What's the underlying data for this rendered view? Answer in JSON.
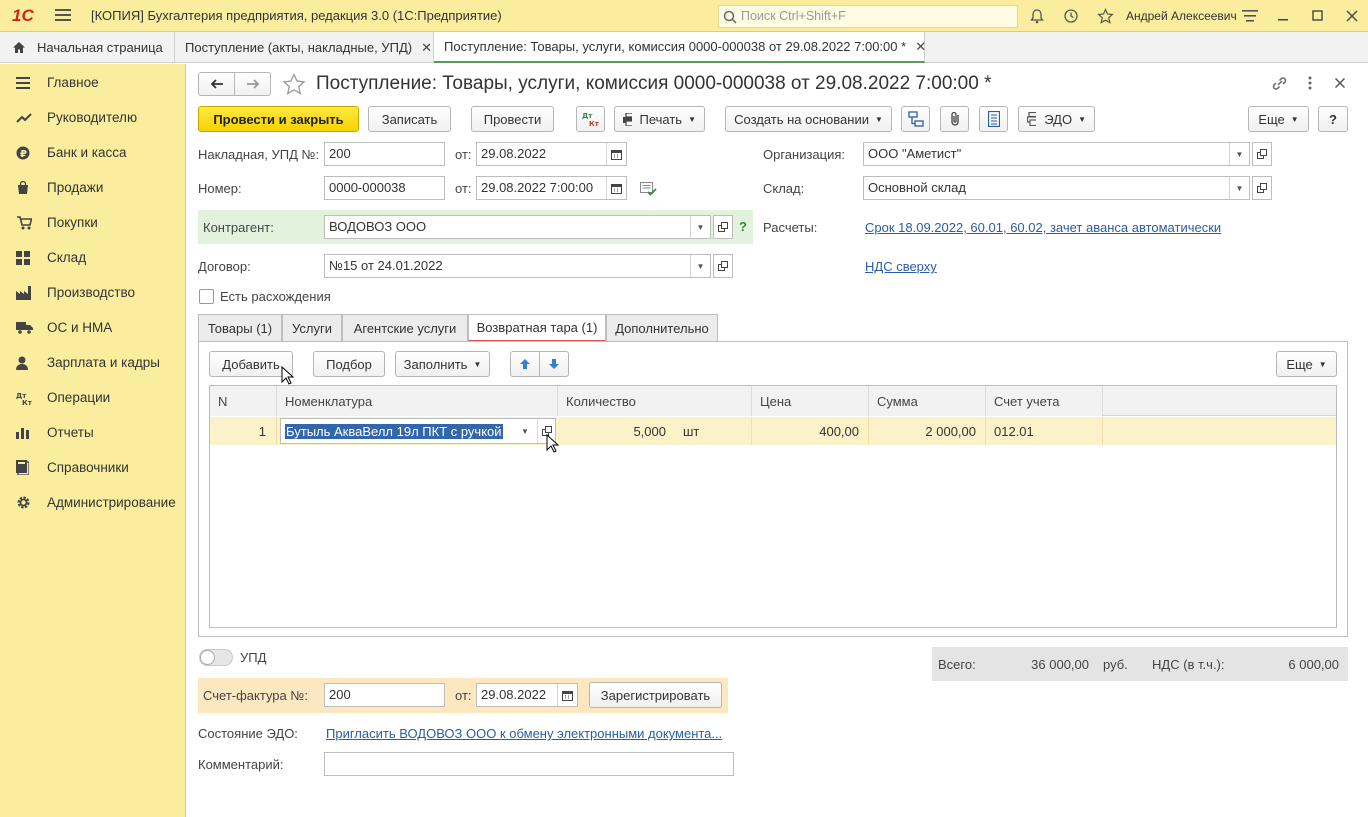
{
  "titlebar": {
    "app_logo": "1С",
    "title": "[КОПИЯ] Бухгалтерия предприятия, редакция 3.0  (1С:Предприятие)",
    "search_placeholder": "Поиск Ctrl+Shift+F",
    "user": "Андрей Алексеевич"
  },
  "tabs": [
    {
      "label": "Начальная страница"
    },
    {
      "label": "Поступление (акты, накладные, УПД)"
    },
    {
      "label": "Поступление: Товары, услуги, комиссия 0000-000038 от 29.08.2022 7:00:00 *"
    }
  ],
  "sidebar": {
    "items": [
      {
        "label": "Главное",
        "icon": "menu-icon"
      },
      {
        "label": "Руководителю",
        "icon": "trend-icon"
      },
      {
        "label": "Банк и касса",
        "icon": "ruble-icon"
      },
      {
        "label": "Продажи",
        "icon": "bag-icon"
      },
      {
        "label": "Покупки",
        "icon": "cart-icon"
      },
      {
        "label": "Склад",
        "icon": "warehouse-icon"
      },
      {
        "label": "Производство",
        "icon": "factory-icon"
      },
      {
        "label": "ОС и НМА",
        "icon": "truck-icon"
      },
      {
        "label": "Зарплата и кадры",
        "icon": "person-icon"
      },
      {
        "label": "Операции",
        "icon": "dt-kt-icon"
      },
      {
        "label": "Отчеты",
        "icon": "bar-chart-icon"
      },
      {
        "label": "Справочники",
        "icon": "book-icon"
      },
      {
        "label": "Администрирование",
        "icon": "gear-icon"
      }
    ]
  },
  "form": {
    "title": "Поступление: Товары, услуги, комиссия 0000-000038 от 29.08.2022 7:00:00 *",
    "toolbar": {
      "post_close": "Провести и закрыть",
      "save": "Записать",
      "post": "Провести",
      "dtkt": "Дт Кт",
      "print": "Печать",
      "create_based": "Создать на основании",
      "edo": "ЭДО",
      "more": "Еще",
      "help": "?"
    },
    "fields": {
      "invoice_label": "Накладная, УПД №:",
      "invoice_value": "200",
      "from_label": "от:",
      "invoice_date": "29.08.2022",
      "number_label": "Номер:",
      "number_value": "0000-000038",
      "number_date": "29.08.2022  7:00:00",
      "org_label": "Организация:",
      "org_value": "ООО \"Аметист\"",
      "warehouse_label": "Склад:",
      "warehouse_value": "Основной склад",
      "counterparty_label": "Контрагент:",
      "counterparty_value": "ВОДОВОЗ ООО",
      "question": "?",
      "settlements_label": "Расчеты:",
      "settlements_link": "Срок 18.09.2022, 60.01, 60.02, зачет аванса автоматически",
      "contract_label": "Договор:",
      "contract_value": "№15 от 24.01.2022",
      "vat_link": "НДС сверху",
      "discrepancy_label": "Есть расхождения"
    },
    "form_tabs": [
      {
        "label": "Товары (1)"
      },
      {
        "label": "Услуги"
      },
      {
        "label": "Агентские услуги"
      },
      {
        "label": "Возвратная тара (1)"
      },
      {
        "label": "Дополнительно"
      }
    ],
    "table_toolbar": {
      "add": "Добавить",
      "pick": "Подбор",
      "fill": "Заполнить",
      "more": "Еще"
    },
    "table": {
      "columns": [
        "N",
        "Номенклатура",
        "Количество",
        "Цена",
        "Сумма",
        "Счет учета"
      ],
      "rows": [
        {
          "n": "1",
          "item": "Бутыль АкваВелл 19л ПКТ с ручкой",
          "qty": "5,000",
          "unit": "шт",
          "price": "400,00",
          "sum": "2 000,00",
          "account": "012.01"
        }
      ]
    },
    "footer": {
      "upd_label": "УПД",
      "total_label": "Всего:",
      "total_value": "36 000,00",
      "currency": "руб.",
      "vat_label": "НДС (в т.ч.):",
      "vat_value": "6 000,00",
      "sf_label": "Счет-фактура №:",
      "sf_value": "200",
      "sf_from": "от:",
      "sf_date": "29.08.2022",
      "register": "Зарегистрировать",
      "edo_label": "Состояние ЭДО:",
      "edo_link": "Пригласить ВОДОВОЗ ООО к обмену электронными документа...",
      "comment_label": "Комментарий:",
      "comment_value": ""
    }
  },
  "colors": {
    "accent_yellow": "#fbed9e",
    "post_button": "#ffe940",
    "counterparty_bg": "#e2f2dc",
    "selected_row": "#fcf2c9",
    "link": "#2a5ca8"
  }
}
